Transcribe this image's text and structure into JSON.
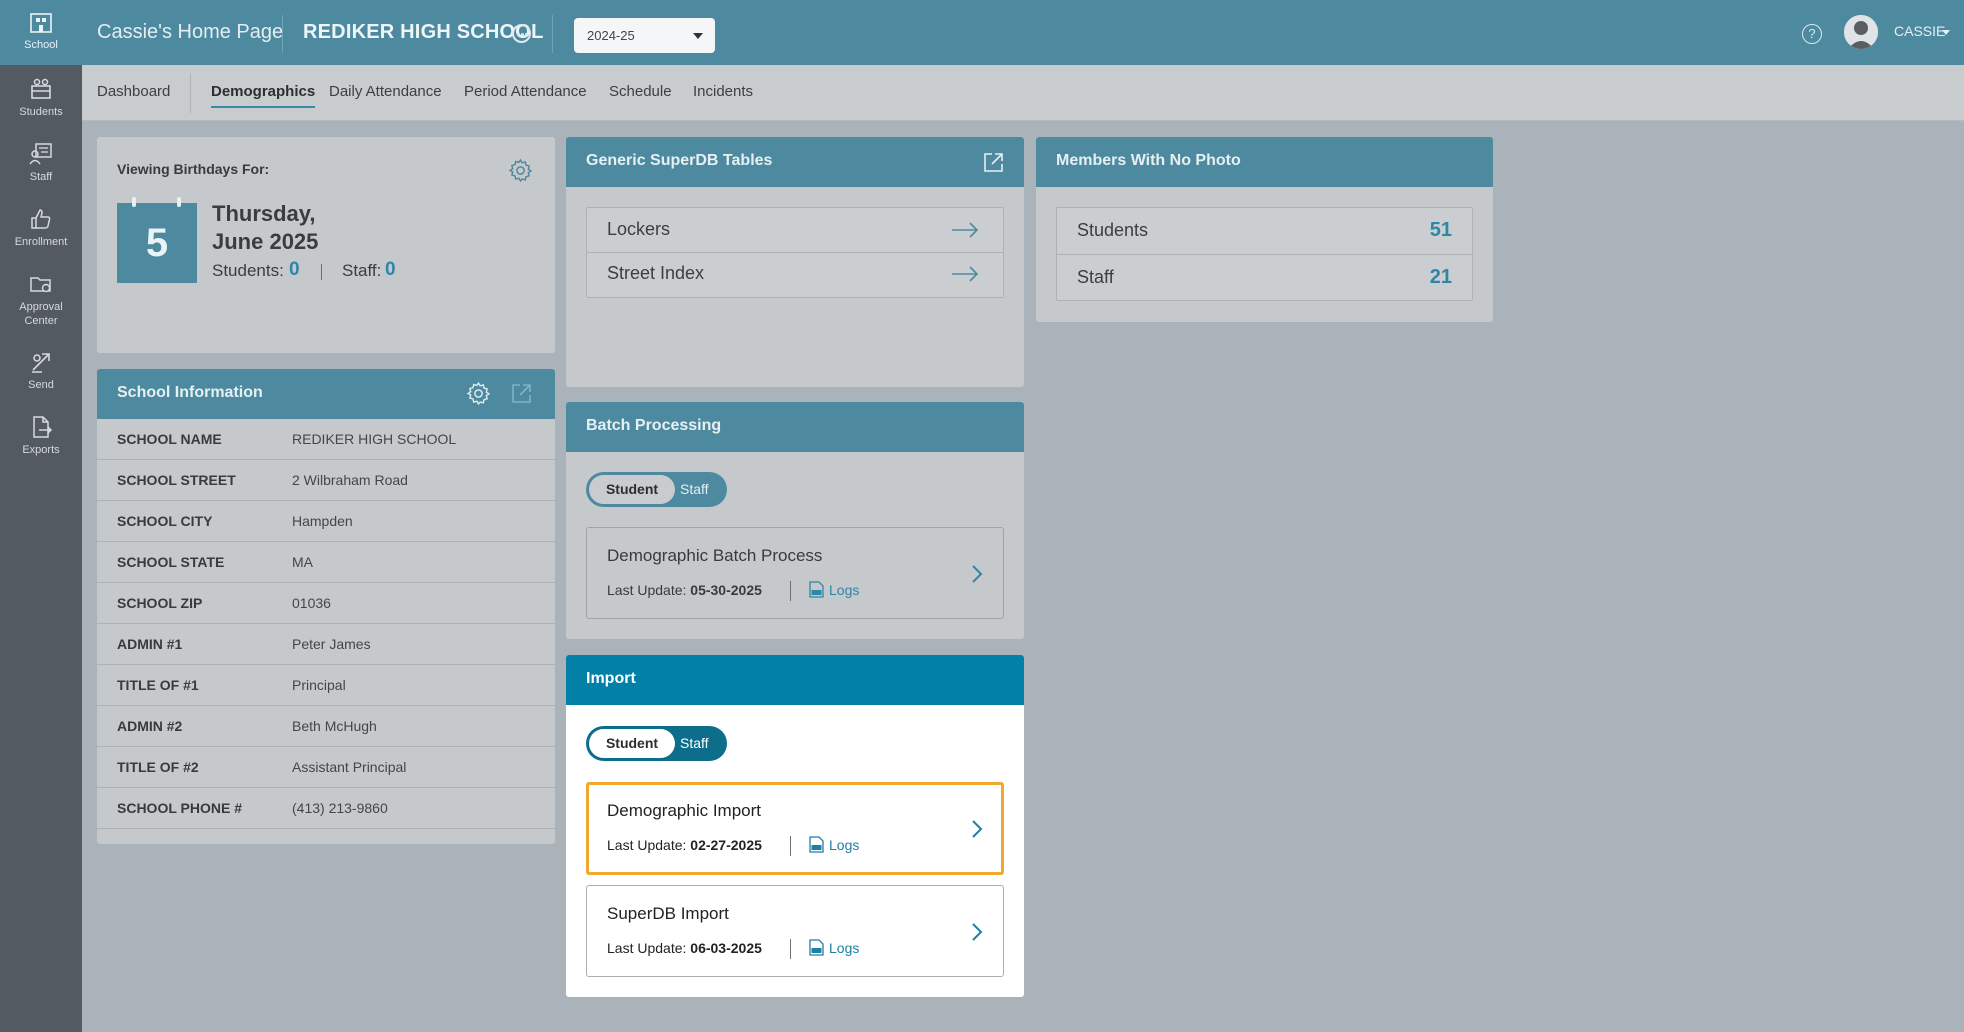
{
  "rail": [
    {
      "label": "School",
      "icon": "school-icon",
      "active": true
    },
    {
      "label": "Students",
      "icon": "students-icon"
    },
    {
      "label": "Staff",
      "icon": "staff-icon"
    },
    {
      "label": "Enrollment",
      "icon": "thumbs-up-icon"
    },
    {
      "label_1": "Approval",
      "label_2": "Center",
      "icon": "folder-icon"
    },
    {
      "label": "Send",
      "icon": "send-icon"
    },
    {
      "label": "Exports",
      "icon": "export-icon"
    }
  ],
  "header": {
    "home_title": "Cassie's Home Page",
    "school_name": "REDIKER HIGH SCHOOL",
    "year": "2024-25",
    "user": "CASSIE"
  },
  "tabs": [
    {
      "label": "Dashboard"
    },
    {
      "label": "Demographics",
      "active": true
    },
    {
      "label": "Daily Attendance"
    },
    {
      "label": "Period Attendance"
    },
    {
      "label": "Schedule"
    },
    {
      "label": "Incidents"
    }
  ],
  "birthdays": {
    "heading": "Viewing Birthdays For:",
    "day": "5",
    "weekday": "Thursday,",
    "month_year": "June 2025",
    "students_label": "Students:",
    "students_count": "0",
    "staff_label": "Staff:",
    "staff_count": "0"
  },
  "school_info": {
    "title": "School Information",
    "rows": [
      {
        "label": "SCHOOL NAME",
        "value": "REDIKER HIGH SCHOOL"
      },
      {
        "label": "SCHOOL STREET",
        "value": "2 Wilbraham Road"
      },
      {
        "label": "SCHOOL CITY",
        "value": "Hampden"
      },
      {
        "label": "SCHOOL STATE",
        "value": "MA"
      },
      {
        "label": "SCHOOL ZIP",
        "value": "01036"
      },
      {
        "label": "ADMIN #1",
        "value": "Peter James"
      },
      {
        "label": "TITLE OF #1",
        "value": "Principal"
      },
      {
        "label": "ADMIN #2",
        "value": "Beth McHugh"
      },
      {
        "label": "TITLE OF #2",
        "value": "Assistant Principal"
      },
      {
        "label": "SCHOOL PHONE #",
        "value": "(413) 213-9860"
      }
    ]
  },
  "superdb": {
    "title": "Generic SuperDB Tables",
    "items": [
      {
        "label": "Lockers"
      },
      {
        "label": "Street Index"
      }
    ]
  },
  "batch": {
    "title": "Batch Processing",
    "toggle_on": "Student",
    "toggle_off": "Staff",
    "items": [
      {
        "title": "Demographic Batch Process",
        "update_label": "Last Update:",
        "date": "05-30-2025",
        "logs": "Logs"
      }
    ]
  },
  "import": {
    "title": "Import",
    "toggle_on": "Student",
    "toggle_off": "Staff",
    "items": [
      {
        "title": "Demographic Import",
        "update_label": "Last Update:",
        "date": "02-27-2025",
        "logs": "Logs",
        "highlighted": true
      },
      {
        "title": "SuperDB Import",
        "update_label": "Last Update:",
        "date": "06-03-2025",
        "logs": "Logs"
      }
    ]
  },
  "no_photo": {
    "title": "Members With No Photo",
    "rows": [
      {
        "label": "Students",
        "count": "51"
      },
      {
        "label": "Staff",
        "count": "21"
      }
    ]
  },
  "colors": {
    "accent": "#4d8aa0",
    "import_header": "#0380a5",
    "highlight": "#f0a830",
    "link": "#2f86a6"
  }
}
